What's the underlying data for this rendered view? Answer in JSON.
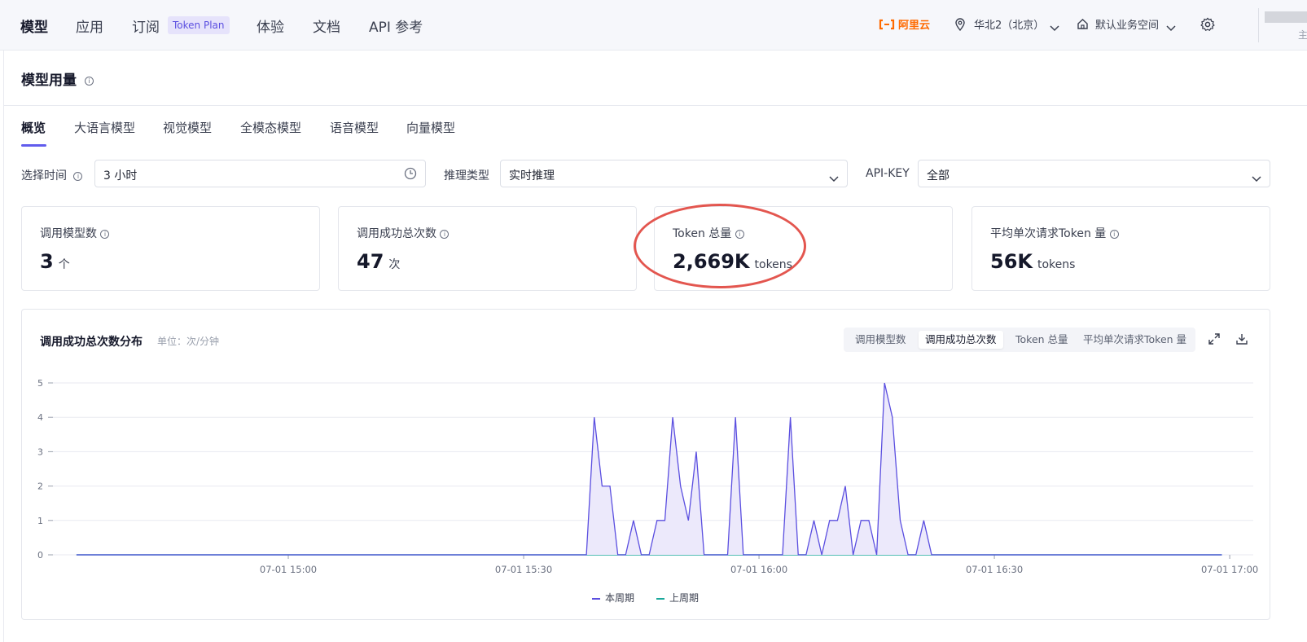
{
  "nav": {
    "items": [
      "模型",
      "应用",
      "订阅",
      "体验",
      "文档",
      "API 参考"
    ],
    "badge": "Token Plan",
    "brand": "阿里云",
    "region": "华北2（北京）",
    "workspace": "默认业务空间",
    "avatar_text": "主"
  },
  "page": {
    "title": "模型用量",
    "tabs": [
      "概览",
      "大语言模型",
      "视觉模型",
      "全模态模型",
      "语音模型",
      "向量模型"
    ]
  },
  "filters": {
    "time_label": "选择时间",
    "time_value": "3 小时",
    "inference_label": "推理类型",
    "inference_value": "实时推理",
    "apikey_label": "API-KEY",
    "apikey_value": "全部"
  },
  "cards": [
    {
      "label": "调用模型数",
      "value": "3",
      "unit": "个"
    },
    {
      "label": "调用成功总次数",
      "value": "47",
      "unit": "次"
    },
    {
      "label": "Token 总量",
      "value": "2,669K",
      "unit": "tokens"
    },
    {
      "label": "平均单次请求Token 量",
      "value": "56K",
      "unit": "tokens"
    }
  ],
  "chart_panel": {
    "title": "调用成功总次数分布",
    "subtitle": "单位：次/分钟",
    "segments": [
      "调用模型数",
      "调用成功总次数",
      "Token 总量",
      "平均单次请求Token 量"
    ],
    "active_segment": 1,
    "legend": [
      "本周期",
      "上周期"
    ]
  },
  "chart_data": {
    "type": "area",
    "xlabel": "",
    "ylabel": "",
    "ylim": [
      0,
      5
    ],
    "yticks": [
      0,
      1,
      2,
      3,
      4,
      5
    ],
    "x_tick_labels": [
      "07-01 15:00",
      "07-01 15:30",
      "07-01 16:00",
      "07-01 16:30",
      "07-01 17:00"
    ],
    "x_tick_minutes": [
      30,
      60,
      90,
      120,
      150
    ],
    "x_range_minutes": [
      3,
      149
    ],
    "grid": true,
    "legend_position": "bottom",
    "colors": {
      "current": "#5b4fe0",
      "previous": "#1aa89b",
      "fill": "#ece9fb"
    },
    "series": [
      {
        "name": "本周期",
        "x": [
          3,
          68,
          69,
          70,
          71,
          72,
          73,
          74,
          75,
          76,
          77,
          78,
          79,
          80,
          81,
          82,
          83,
          84,
          85,
          86,
          87,
          88,
          89,
          90,
          91,
          92,
          93,
          94,
          95,
          96,
          97,
          98,
          99,
          100,
          101,
          102,
          103,
          104,
          105,
          106,
          107,
          108,
          109,
          110,
          111,
          112,
          113,
          114,
          115,
          149
        ],
        "y": [
          0,
          0,
          4,
          2,
          2,
          0,
          0,
          1,
          0,
          0,
          1,
          1,
          4,
          2,
          1,
          3,
          0,
          0,
          0,
          0,
          4,
          0,
          0,
          0,
          0,
          0,
          0,
          4,
          0,
          0,
          1,
          0,
          1,
          1,
          2,
          0,
          1,
          1,
          0,
          5,
          4,
          1,
          0,
          0,
          1,
          0,
          0,
          0,
          0,
          0
        ]
      },
      {
        "name": "上周期",
        "x": [
          3,
          149
        ],
        "y": [
          0,
          0
        ]
      }
    ]
  }
}
